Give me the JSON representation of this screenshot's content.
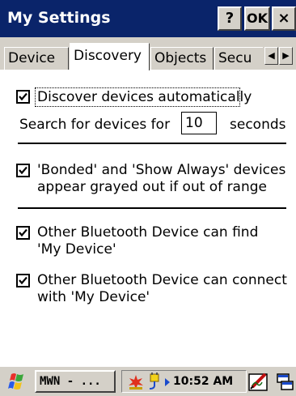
{
  "window": {
    "title": "My Settings",
    "help_label": "?",
    "ok_label": "OK",
    "close_label": "×"
  },
  "tabs": [
    {
      "label": "Device",
      "active": false
    },
    {
      "label": "Discovery",
      "active": true
    },
    {
      "label": "Objects",
      "active": false
    },
    {
      "label": "Secu",
      "active": false
    }
  ],
  "tab_scroll": {
    "left": "◀",
    "right": "▶"
  },
  "discovery": {
    "auto_discover_label": "Discover devices automatically",
    "auto_discover_checked": true,
    "search_prefix": "Search for devices for",
    "search_value": "10",
    "search_suffix": "seconds",
    "grayed_line1": "'Bonded' and 'Show Always' devices",
    "grayed_line2": "appear grayed out if out of range",
    "grayed_checked": true,
    "find_line1": "Other Bluetooth Device can find",
    "find_line2": "'My Device'",
    "find_checked": true,
    "connect_line1": "Other Bluetooth Device can connect",
    "connect_line2": "with 'My Device'",
    "connect_checked": true
  },
  "taskbar": {
    "task_label": "MWN - ...",
    "clock": "10:52 AM",
    "icons": [
      "start-flag-icon",
      "bluetooth-star-icon",
      "connection-plug-icon",
      "arrow-right-icon",
      "keyboard-pen-icon",
      "input-panel-icon"
    ]
  },
  "colors": {
    "titlebar": "#0a246a",
    "chrome": "#d4d0c8",
    "content": "#ffffff"
  }
}
